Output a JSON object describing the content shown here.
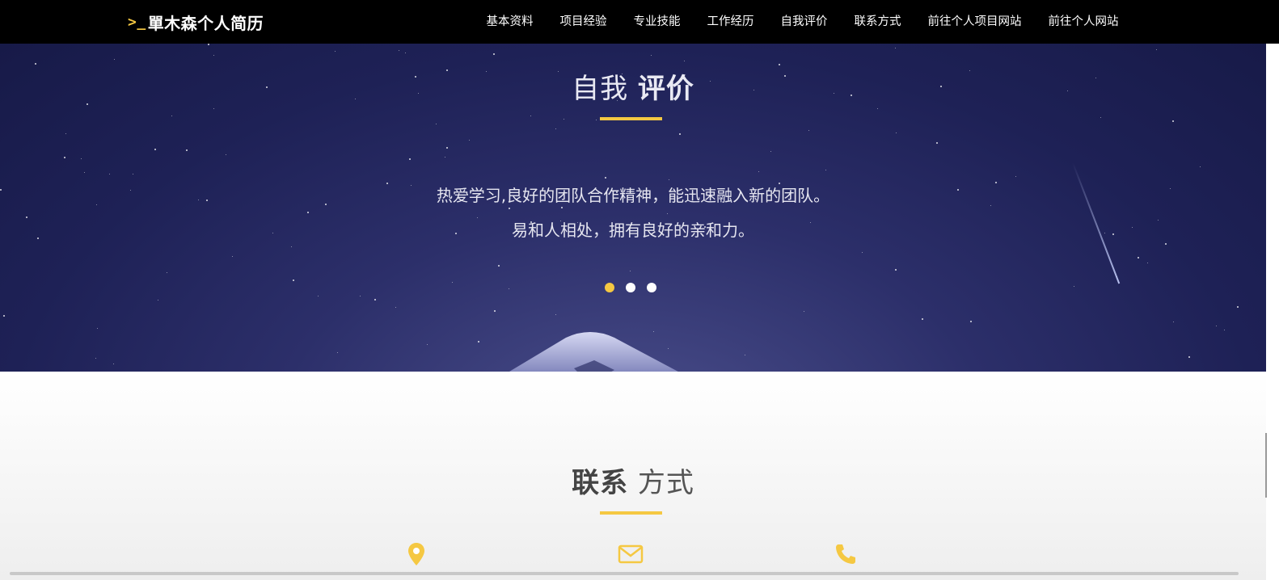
{
  "brand": {
    "prompt": ">_",
    "name": "單木森个人简历"
  },
  "nav": {
    "items": [
      {
        "label": "基本资料"
      },
      {
        "label": "项目经验"
      },
      {
        "label": "专业技能"
      },
      {
        "label": "工作经历"
      },
      {
        "label": "自我评价"
      },
      {
        "label": "联系方式"
      },
      {
        "label": "前往个人项目网站"
      },
      {
        "label": "前往个人网站"
      }
    ]
  },
  "self_eval": {
    "title_light": "自我",
    "title_bold": "评价",
    "lines": [
      "热爱学习,良好的团队合作精神，能迅速融入新的团队。",
      "易和人相处，拥有良好的亲和力。"
    ],
    "carousel_active": 1,
    "carousel_count": 3
  },
  "contact": {
    "title_bold": "联系",
    "title_light": "方式",
    "icons": [
      "location-pin-icon",
      "envelope-icon",
      "phone-icon"
    ]
  },
  "colors": {
    "accent": "#f5c842",
    "navbar": "#000000",
    "hero_bg": "#1e2156"
  }
}
